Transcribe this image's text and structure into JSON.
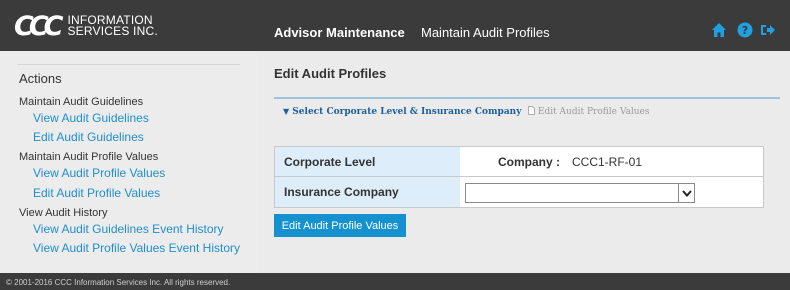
{
  "header": {
    "logo_mark": "CCC",
    "logo_line1": "INFORMATION",
    "logo_line2": "SERVICES INC.",
    "app_title": "Advisor Maintenance",
    "page_subtitle": "Maintain Audit Profiles",
    "icons": [
      "home-icon",
      "help-icon",
      "logout-icon"
    ],
    "icon_color": "#1fa0e0"
  },
  "sidebar": {
    "heading": "Actions",
    "groups": [
      {
        "label": "Maintain Audit Guidelines",
        "links": [
          "View Audit Guidelines",
          "Edit Audit Guidelines"
        ]
      },
      {
        "label": "Maintain Audit Profile Values",
        "links": [
          "View Audit Profile Values",
          "Edit Audit Profile Values"
        ]
      },
      {
        "label": "View Audit History",
        "links": [
          "View Audit Guidelines Event History",
          "View Audit Profile Values Event History"
        ]
      }
    ]
  },
  "main": {
    "title": "Edit Audit Profiles",
    "tabs": [
      {
        "label": "Select Corporate Level & Insurance Company",
        "active": true
      },
      {
        "label": "Edit Audit Profile Values",
        "active": false
      }
    ],
    "form": {
      "corporate_level_label": "Corporate Level",
      "company_label": "Company :",
      "company_value": "CCC1-RF-01",
      "insurance_company_label": "Insurance Company",
      "insurance_company_value": ""
    },
    "action_button": "Edit Audit Profile Values"
  },
  "footer": {
    "copyright": "© 2001-2016 CCC Information Services Inc. All rights reserved."
  }
}
